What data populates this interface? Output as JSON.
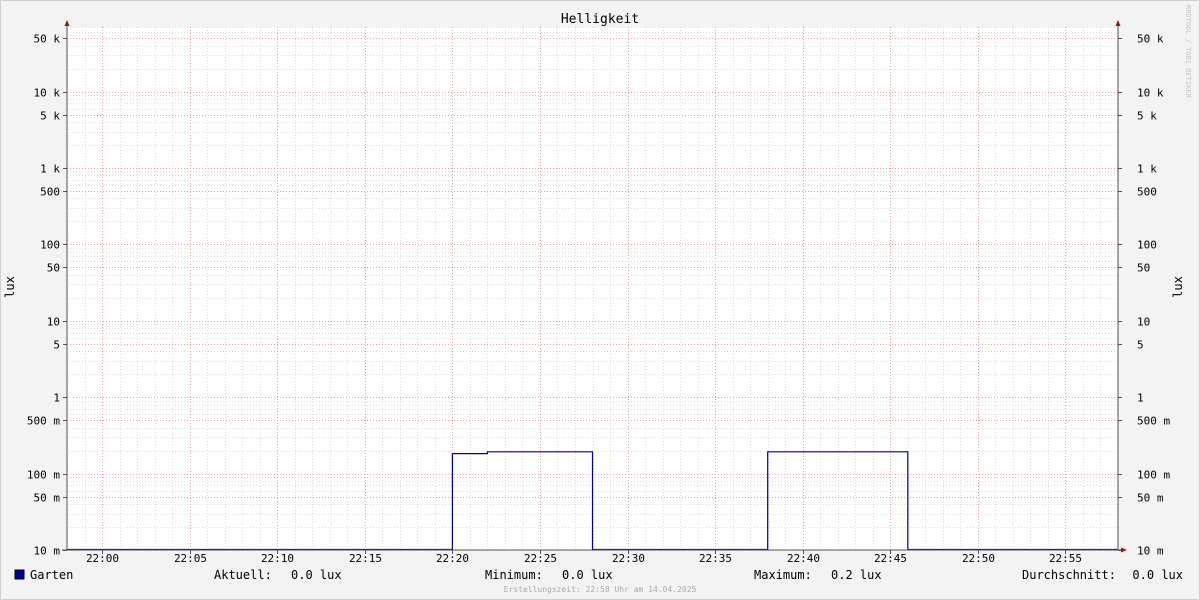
{
  "chart_data": {
    "type": "line",
    "title": "Helligkeit",
    "ylabel": "lux",
    "ylabel_right": "lux",
    "y_scale": "log",
    "ylim": [
      0.01,
      70000
    ],
    "y_ticks": [
      {
        "value": 50000,
        "label": "50 k"
      },
      {
        "value": 10000,
        "label": "10 k"
      },
      {
        "value": 5000,
        "label": "5 k"
      },
      {
        "value": 1000,
        "label": "1 k"
      },
      {
        "value": 500,
        "label": "500"
      },
      {
        "value": 100,
        "label": "100"
      },
      {
        "value": 50,
        "label": "50"
      },
      {
        "value": 10,
        "label": "10"
      },
      {
        "value": 5,
        "label": "5"
      },
      {
        "value": 1,
        "label": "1"
      },
      {
        "value": 0.5,
        "label": "500 m"
      },
      {
        "value": 0.1,
        "label": "100 m"
      },
      {
        "value": 0.05,
        "label": "50 m"
      },
      {
        "value": 0.01,
        "label": "10 m"
      }
    ],
    "xlim": [
      "21:58",
      "22:58"
    ],
    "x_ticks": [
      "22:00",
      "22:05",
      "22:10",
      "22:15",
      "22:20",
      "22:25",
      "22:30",
      "22:35",
      "22:40",
      "22:45",
      "22:50",
      "22:55"
    ],
    "grid": true,
    "series": [
      {
        "name": "Garten",
        "color": "#000099",
        "points": [
          {
            "x": "21:58",
            "y": 0.01
          },
          {
            "x": "22:20",
            "y": 0.01
          },
          {
            "x": "22:20",
            "y": 0.18
          },
          {
            "x": "22:22",
            "y": 0.18
          },
          {
            "x": "22:22",
            "y": 0.19
          },
          {
            "x": "22:28",
            "y": 0.19
          },
          {
            "x": "22:28",
            "y": 0.01
          },
          {
            "x": "22:38",
            "y": 0.01
          },
          {
            "x": "22:38",
            "y": 0.19
          },
          {
            "x": "22:46",
            "y": 0.19
          },
          {
            "x": "22:46",
            "y": 0.01
          },
          {
            "x": "22:58",
            "y": 0.01
          }
        ]
      }
    ],
    "legend": {
      "placement": "bottom",
      "series_name": "Garten",
      "color": "#000099",
      "stats": [
        {
          "label": "Aktuell:",
          "value": "0.0 lux"
        },
        {
          "label": "Minimum:",
          "value": "0.0 lux"
        },
        {
          "label": "Maximum:",
          "value": "0.2 lux"
        },
        {
          "label": "Durchschnitt:",
          "value": "0.0 lux"
        }
      ]
    },
    "footer": "Erstellungszeit: 22:58 Uhr am 14.04.2025",
    "watermark": "RRDTOOL / TOBI OETIKER"
  }
}
